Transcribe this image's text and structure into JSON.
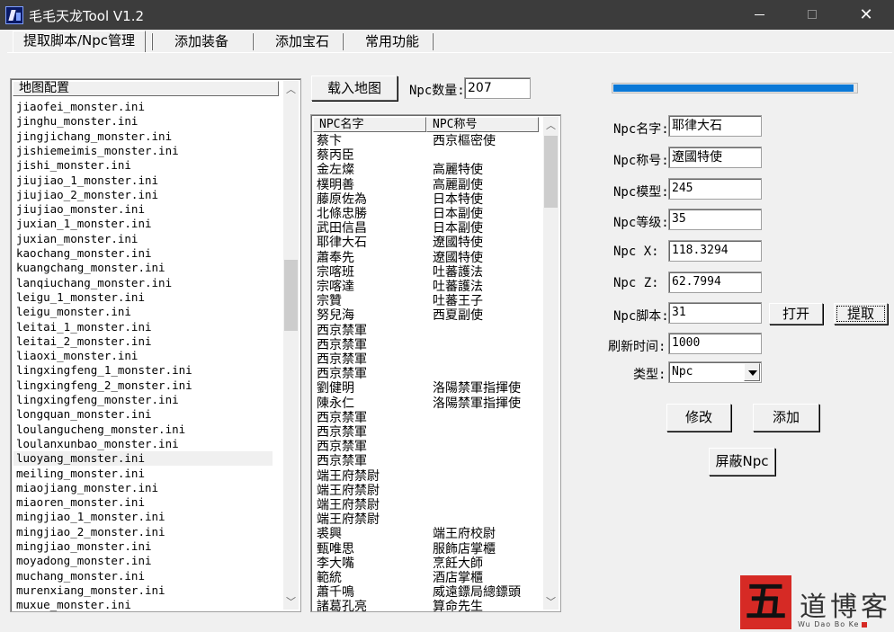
{
  "window": {
    "title": "毛毛天龙Tool V1.2",
    "minimize": "",
    "close": "✕"
  },
  "tabs": [
    {
      "label": "提取脚本/Npc管理"
    },
    {
      "label": "添加装备"
    },
    {
      "label": "添加宝石"
    },
    {
      "label": "常用功能"
    }
  ],
  "map_list": {
    "header": "地图配置",
    "selected_item": "luoyang_monster.ini",
    "items": [
      "jiaofei_monster.ini",
      "jinghu_monster.ini",
      "jingjichang_monster.ini",
      "jishiemeimis_monster.ini",
      "jishi_monster.ini",
      "jiujiao_1_monster.ini",
      "jiujiao_2_monster.ini",
      "jiujiao_monster.ini",
      "juxian_1_monster.ini",
      "juxian_monster.ini",
      "kaochang_monster.ini",
      "kuangchang_monster.ini",
      "lanqiuchang_monster.ini",
      "leigu_1_monster.ini",
      "leigu_monster.ini",
      "leitai_1_monster.ini",
      "leitai_2_monster.ini",
      "liaoxi_monster.ini",
      "lingxingfeng_1_monster.ini",
      "lingxingfeng_2_monster.ini",
      "lingxingfeng_monster.ini",
      "longquan_monster.ini",
      "loulangucheng_monster.ini",
      "loulanxunbao_monster.ini",
      "luoyang_monster.ini",
      "meiling_monster.ini",
      "miaojiang_monster.ini",
      "miaoren_monster.ini",
      "mingjiao_1_monster.ini",
      "mingjiao_2_monster.ini",
      "mingjiao_monster.ini",
      "moyadong_monster.ini",
      "muchang_monster.ini",
      "murenxiang_monster.ini",
      "muxue_monster.ini"
    ]
  },
  "load_map_button": "载入地图",
  "npc_count": {
    "label": "Npc数量:",
    "value": "207"
  },
  "npc_table": {
    "columns": [
      "NPC名字",
      "NPC称号"
    ],
    "rows": [
      [
        "蔡卞",
        "西京樞密使"
      ],
      [
        "蔡丙臣",
        ""
      ],
      [
        "金左燦",
        "高麗特使"
      ],
      [
        "樸明善",
        "高麗副使"
      ],
      [
        "藤原佐為",
        "日本特使"
      ],
      [
        "北條忠勝",
        "日本副使"
      ],
      [
        "武田信昌",
        "日本副使"
      ],
      [
        "耶律大石",
        "遼國特使"
      ],
      [
        "蕭奉先",
        "遼國特使"
      ],
      [
        "宗喀班",
        "吐蕃護法"
      ],
      [
        "宗喀達",
        "吐蕃護法"
      ],
      [
        "宗贊",
        "吐蕃王子"
      ],
      [
        "努兒海",
        "西夏副使"
      ],
      [
        "西京禁軍",
        ""
      ],
      [
        "西京禁軍",
        ""
      ],
      [
        "西京禁軍",
        ""
      ],
      [
        "西京禁軍",
        ""
      ],
      [
        "劉健明",
        "洛陽禁軍指揮使"
      ],
      [
        "陳永仁",
        "洛陽禁軍指揮使"
      ],
      [
        "西京禁軍",
        ""
      ],
      [
        "西京禁軍",
        ""
      ],
      [
        "西京禁軍",
        ""
      ],
      [
        "西京禁軍",
        ""
      ],
      [
        "端王府禁尉",
        ""
      ],
      [
        "端王府禁尉",
        ""
      ],
      [
        "端王府禁尉",
        ""
      ],
      [
        "端王府禁尉",
        ""
      ],
      [
        "裘興",
        "端王府校尉"
      ],
      [
        "甄唯思",
        "服飾店掌櫃"
      ],
      [
        "李大嘴",
        "烹飪大師"
      ],
      [
        "範統",
        "酒店掌櫃"
      ],
      [
        "蕭千鳴",
        "威遠鏢局總鏢頭"
      ],
      [
        "諸葛孔亮",
        "算命先生"
      ]
    ]
  },
  "progress": {
    "value_fraction": 0.99
  },
  "form": {
    "name_label": "Npc名字:",
    "name_value": "耶律大石",
    "title_label": "Npc称号:",
    "title_value": "遼國特使",
    "model_label": "Npc模型:",
    "model_value": "245",
    "level_label": "Npc等级:",
    "level_value": "35",
    "x_label": "Npc  X:",
    "x_value": "118.3294",
    "z_label": "Npc  Z:",
    "z_value": "62.7994",
    "script_label": "Npc脚本:",
    "script_value": "31",
    "refresh_label": "刷新时间:",
    "refresh_value": "1000",
    "type_label": "类型:",
    "type_value": "Npc"
  },
  "buttons": {
    "open": "打开",
    "extract": "提取",
    "modify": "修改",
    "add": "添加",
    "hide_npc": "屏蔽Npc"
  },
  "watermark": {
    "seal": "五",
    "text": "道博客",
    "sub": "Wu Dao Bo Ke"
  },
  "colors": {
    "titlebar": "#3c3c3c",
    "progress": "#0a78d7",
    "seal": "#d62a25"
  }
}
